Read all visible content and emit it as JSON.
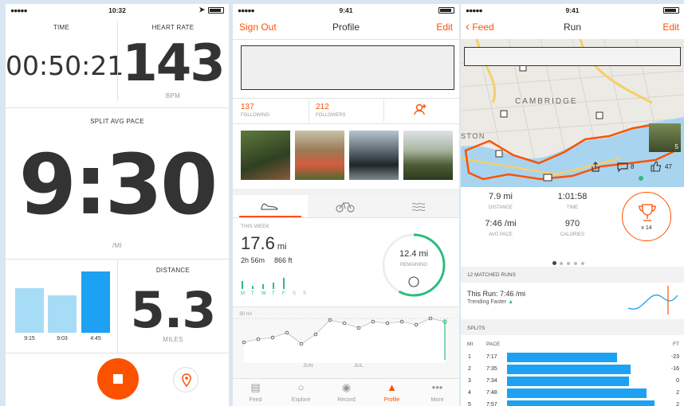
{
  "record": {
    "status_time": "10:32",
    "time_label": "TIME",
    "time_value": "00:50:21",
    "hr_label": "HEART RATE",
    "hr_value": "143",
    "hr_unit": "BPM",
    "pace_label": "SPLIT AVG PACE",
    "pace_value": "9:30",
    "pace_unit": "/MI",
    "splits": [
      {
        "label": "9:15",
        "value": 0.62
      },
      {
        "label": "9:03",
        "value": 0.52
      },
      {
        "label": "4:45",
        "value": 0.85
      }
    ],
    "distance_label": "DISTANCE",
    "distance_value": "5.3",
    "distance_unit": "MILES"
  },
  "profile": {
    "status_time": "9:41",
    "sign_out": "Sign Out",
    "title": "Profile",
    "edit": "Edit",
    "following_count": "137",
    "following_label": "FOLLOWING",
    "followers_count": "212",
    "followers_label": "FOLLOWERS",
    "week_label": "THIS WEEK",
    "week_distance": "17.6",
    "week_distance_unit": "mi",
    "week_time": "2h 56m",
    "week_elev": "866 ft",
    "days": [
      "M",
      "T",
      "W",
      "T",
      "F",
      "S",
      "S"
    ],
    "ring_value": "12.4 mi",
    "ring_label": "REMAINING",
    "ring_fraction": 0.58,
    "chart_top_label": "30 mi",
    "month_labels": [
      "JUN",
      "JUL"
    ],
    "tabs": [
      "Feed",
      "Explore",
      "Record",
      "Profile",
      "More"
    ]
  },
  "activity": {
    "status_time": "9:41",
    "back": "Feed",
    "title": "Run",
    "edit": "Edit",
    "map_city": "CAMBRIDGE",
    "map_city2": "STON",
    "comments": "8",
    "kudos": "47",
    "photo_count": "5",
    "distance": "7.9 mi",
    "distance_label": "DISTANCE",
    "time": "1:01:58",
    "time_label": "TIME",
    "pace": "7:46 /mi",
    "pace_label": "AVG PACE",
    "calories": "970",
    "calories_label": "CALORIES",
    "trophy_label": "x 14",
    "matched_header": "12 MATCHED RUNS",
    "this_run": "This Run: 7:46 /mi",
    "trend": "Trending Faster",
    "splits_header": "SPLITS",
    "col_mi": "MI",
    "col_pace": "PACE",
    "col_ft": "FT",
    "splits": [
      {
        "mi": "1",
        "pace": "7:17",
        "ft": "-23",
        "frac": 0.55
      },
      {
        "mi": "2",
        "pace": "7:35",
        "ft": "-16",
        "frac": 0.62
      },
      {
        "mi": "3",
        "pace": "7:34",
        "ft": "0",
        "frac": 0.61
      },
      {
        "mi": "4",
        "pace": "7:48",
        "ft": "2",
        "frac": 0.7
      },
      {
        "mi": "5",
        "pace": "7:57",
        "ft": "2",
        "frac": 0.74
      }
    ]
  }
}
